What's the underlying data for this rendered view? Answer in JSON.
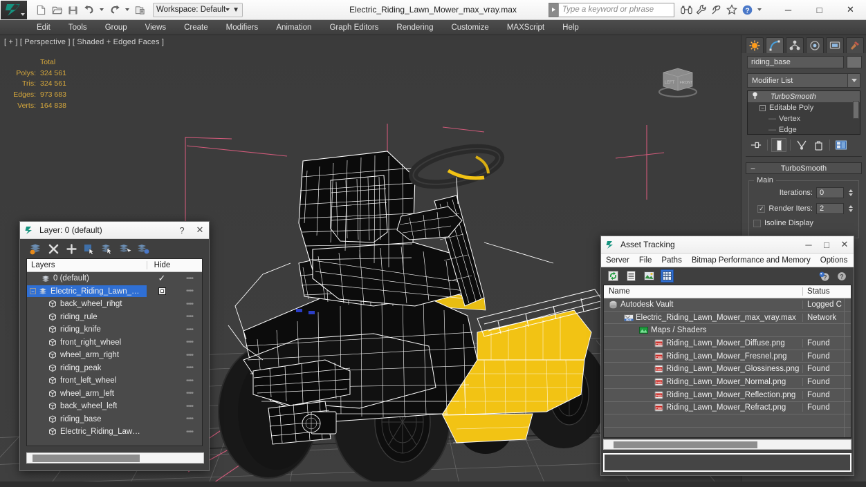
{
  "titlebar": {
    "app_icon": "3dsmax-logo-icon",
    "quick_access": [
      {
        "name": "new-file-button",
        "icon": "new-file-icon"
      },
      {
        "name": "open-file-button",
        "icon": "open-folder-icon"
      },
      {
        "name": "save-file-button",
        "icon": "save-disk-icon"
      },
      {
        "name": "undo-button",
        "icon": "undo-arrow-icon"
      },
      {
        "name": "redo-button",
        "icon": "redo-arrow-icon"
      },
      {
        "name": "project-folder-button",
        "icon": "project-folder-icon"
      }
    ],
    "workspace_label": "Workspace: Default",
    "file_title": "Electric_Riding_Lawn_Mower_max_vray.max",
    "search_placeholder": "Type a keyword or phrase",
    "right_icons": [
      {
        "name": "binoculars-icon",
        "glyph": "binoculars"
      },
      {
        "name": "wrench-icon",
        "glyph": "wrench"
      },
      {
        "name": "satellite-dish-icon",
        "glyph": "dish"
      },
      {
        "name": "star-icon",
        "glyph": "star"
      },
      {
        "name": "help-icon",
        "glyph": "help"
      }
    ],
    "window_controls": {
      "minimize": "─",
      "maximize": "□",
      "close": "✕"
    }
  },
  "menubar": {
    "items": [
      "Edit",
      "Tools",
      "Group",
      "Views",
      "Create",
      "Modifiers",
      "Animation",
      "Graph Editors",
      "Rendering",
      "Customize",
      "MAXScript",
      "Help"
    ]
  },
  "viewport": {
    "label": "[ + ] [ Perspective ] [ Shaded + Edged Faces ]",
    "stats": {
      "column_header": "Total",
      "rows": [
        {
          "label": "Polys:",
          "value": "324 561"
        },
        {
          "label": "Tris:",
          "value": "324 561"
        },
        {
          "label": "Edges:",
          "value": "973 683"
        },
        {
          "label": "Verts:",
          "value": "164 838"
        }
      ]
    },
    "viewcube_labels": [
      "LEFT",
      "FRONT"
    ],
    "colors": {
      "background": "#3b3b3b",
      "grid": "#6a6a6a",
      "wireframe": "#ffffff",
      "highlight_yellow": "#f2c314",
      "axis_red": "#b02b3b",
      "helper_pink": "#d05a7a"
    }
  },
  "command_panel": {
    "tabs": [
      {
        "name": "tab-create",
        "icon": "create-star-icon",
        "active": false
      },
      {
        "name": "tab-modify",
        "icon": "modify-curve-icon",
        "active": true
      },
      {
        "name": "tab-hierarchy",
        "icon": "hierarchy-icon",
        "active": false
      },
      {
        "name": "tab-motion",
        "icon": "motion-wheel-icon",
        "active": false
      },
      {
        "name": "tab-display",
        "icon": "display-monitor-icon",
        "active": false
      },
      {
        "name": "tab-utilities",
        "icon": "utilities-hammer-icon",
        "active": false
      }
    ],
    "object_name": "riding_base",
    "modifier_list_label": "Modifier List",
    "modifier_stack": [
      {
        "label": "TurboSmooth",
        "selected": true,
        "italic": true
      },
      {
        "label": "Editable Poly",
        "selected": false,
        "italic": false
      },
      {
        "label": "Vertex",
        "selected": false,
        "sub": true
      },
      {
        "label": "Edge",
        "selected": false,
        "sub": true
      }
    ],
    "stack_tools": [
      {
        "name": "pin-stack-button",
        "icon": "pin-icon"
      },
      {
        "name": "show-end-result-button",
        "icon": "show-end-result-icon"
      },
      {
        "name": "make-unique-button",
        "icon": "make-unique-icon"
      },
      {
        "name": "remove-modifier-button",
        "icon": "trash-icon"
      },
      {
        "name": "configure-modifier-sets-button",
        "icon": "configure-sets-icon"
      }
    ],
    "rollout": {
      "title": "TurboSmooth",
      "group_title": "Main",
      "iterations_label": "Iterations:",
      "iterations_value": "0",
      "render_iters_label": "Render Iters:",
      "render_iters_value": "2",
      "render_iters_checked": true,
      "isoline_label": "Isoline Display",
      "isoline_checked": false
    }
  },
  "layer_dialog": {
    "title": "Layer: 0 (default)",
    "help_glyph": "?",
    "close_glyph": "✕",
    "toolbar": [
      {
        "name": "create-new-layer-button",
        "icon": "new-layer-icon"
      },
      {
        "name": "delete-layer-button",
        "icon": "delete-x-icon"
      },
      {
        "name": "add-selection-to-layer-button",
        "icon": "plus-icon"
      },
      {
        "name": "select-objects-in-layer-button",
        "icon": "select-objects-icon"
      },
      {
        "name": "highlight-selected-objects-button",
        "icon": "highlight-layer-icon"
      },
      {
        "name": "hide-unhide-layer-button",
        "icon": "hide-layer-icon"
      },
      {
        "name": "layer-properties-button",
        "icon": "layer-properties-icon"
      }
    ],
    "columns": {
      "name": "Layers",
      "hide": "Hide"
    },
    "rows": [
      {
        "label": "0 (default)",
        "indent": 1,
        "icon": "layer-icon",
        "hide": "check",
        "expander": false,
        "selected": false
      },
      {
        "label": "Electric_Riding_Lawn_Mower",
        "indent": 0,
        "icon": "layer-icon",
        "hide": "box",
        "expander": true,
        "selected": true
      },
      {
        "label": "back_wheel_rihgt",
        "indent": 2,
        "icon": "object-box-icon",
        "hide": "",
        "expander": false,
        "selected": false
      },
      {
        "label": "riding_rule",
        "indent": 2,
        "icon": "object-box-icon",
        "hide": "",
        "expander": false,
        "selected": false
      },
      {
        "label": "riding_knife",
        "indent": 2,
        "icon": "object-box-icon",
        "hide": "",
        "expander": false,
        "selected": false
      },
      {
        "label": "front_right_wheel",
        "indent": 2,
        "icon": "object-box-icon",
        "hide": "",
        "expander": false,
        "selected": false
      },
      {
        "label": "wheel_arm_right",
        "indent": 2,
        "icon": "object-box-icon",
        "hide": "",
        "expander": false,
        "selected": false
      },
      {
        "label": "riding_peak",
        "indent": 2,
        "icon": "object-box-icon",
        "hide": "",
        "expander": false,
        "selected": false
      },
      {
        "label": "front_left_wheel",
        "indent": 2,
        "icon": "object-box-icon",
        "hide": "",
        "expander": false,
        "selected": false
      },
      {
        "label": "wheel_arm_left",
        "indent": 2,
        "icon": "object-box-icon",
        "hide": "",
        "expander": false,
        "selected": false
      },
      {
        "label": "back_wheel_left",
        "indent": 2,
        "icon": "object-box-icon",
        "hide": "",
        "expander": false,
        "selected": false
      },
      {
        "label": "riding_base",
        "indent": 2,
        "icon": "object-box-icon",
        "hide": "",
        "expander": false,
        "selected": false
      },
      {
        "label": "Electric_Riding_Lawn_Mower",
        "indent": 2,
        "icon": "object-box-icon",
        "hide": "",
        "expander": false,
        "selected": false
      }
    ]
  },
  "asset_tracking": {
    "title": "Asset Tracking",
    "window_controls": {
      "minimize": "─",
      "maximize": "□",
      "close": "✕"
    },
    "menu": [
      "Server",
      "File",
      "Paths",
      "Bitmap Performance and Memory",
      "Options"
    ],
    "toolbar": [
      {
        "name": "refresh-button",
        "icon": "refresh-icon",
        "active": false
      },
      {
        "name": "list-view-button",
        "icon": "list-view-icon",
        "active": false
      },
      {
        "name": "thumbnail-view-button",
        "icon": "thumbnail-view-icon",
        "active": false
      },
      {
        "name": "grid-view-button",
        "icon": "grid-view-icon",
        "active": true
      },
      {
        "name": "help-button",
        "icon": "help-icon",
        "active": false
      },
      {
        "name": "about-button",
        "icon": "about-icon",
        "active": false
      }
    ],
    "columns": {
      "name": "Name",
      "status": "Status"
    },
    "rows": [
      {
        "label": "Autodesk Vault",
        "status": "Logged C",
        "indent": 0,
        "icon": "vault-icon"
      },
      {
        "label": "Electric_Riding_Lawn_Mower_max_vray.max",
        "status": "Network",
        "indent": 1,
        "icon": "max-file-icon"
      },
      {
        "label": "Maps / Shaders",
        "status": "",
        "indent": 2,
        "icon": "maps-shaders-icon"
      },
      {
        "label": "Riding_Lawn_Mower_Diffuse.png",
        "status": "Found",
        "indent": 3,
        "icon": "png-file-icon"
      },
      {
        "label": "Riding_Lawn_Mower_Fresnel.png",
        "status": "Found",
        "indent": 3,
        "icon": "png-file-icon"
      },
      {
        "label": "Riding_Lawn_Mower_Glossiness.png",
        "status": "Found",
        "indent": 3,
        "icon": "png-file-icon"
      },
      {
        "label": "Riding_Lawn_Mower_Normal.png",
        "status": "Found",
        "indent": 3,
        "icon": "png-file-icon"
      },
      {
        "label": "Riding_Lawn_Mower_Reflection.png",
        "status": "Found",
        "indent": 3,
        "icon": "png-file-icon"
      },
      {
        "label": "Riding_Lawn_Mower_Refract.png",
        "status": "Found",
        "indent": 3,
        "icon": "png-file-icon"
      }
    ]
  }
}
